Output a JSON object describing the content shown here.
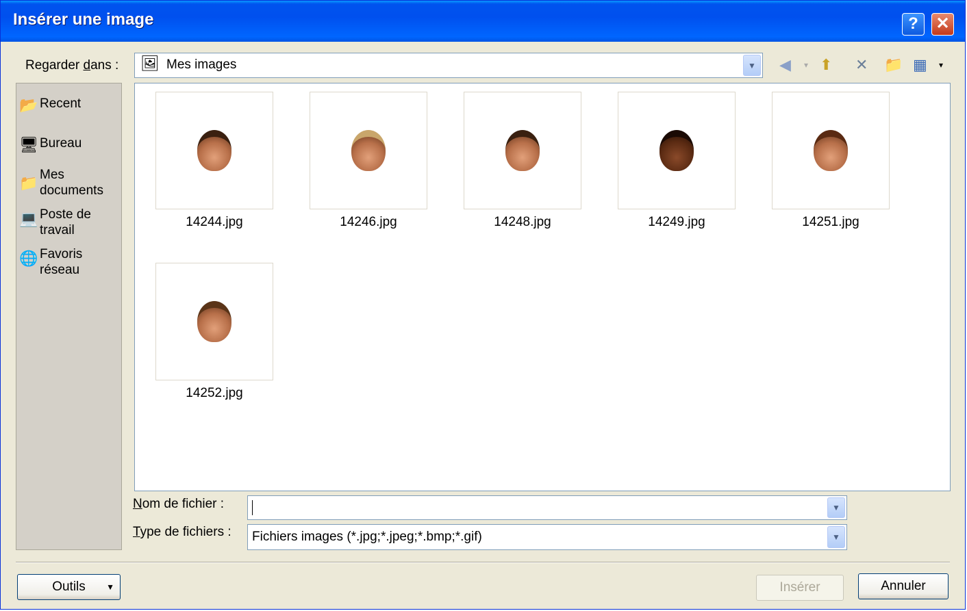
{
  "window": {
    "title": "Insérer une image",
    "help_button": "?",
    "close_button": "✕"
  },
  "lookin": {
    "label_pre": "Regarder ",
    "label_key": "d",
    "label_post": "ans :",
    "value": "Mes images"
  },
  "toolbar": {
    "icons": [
      "back-icon",
      "up-folder-icon",
      "delete-icon",
      "new-folder-icon",
      "views-menu-icon"
    ]
  },
  "places": [
    {
      "label": "Recent",
      "icon": "recent-folder-icon"
    },
    {
      "label": "Bureau",
      "icon": "desktop-icon"
    },
    {
      "label": "Mes\ndocuments",
      "icon": "my-documents-icon"
    },
    {
      "label": "Poste de\ntravail",
      "icon": "my-computer-icon"
    },
    {
      "label": "Favoris\nréseau",
      "icon": "network-places-icon"
    }
  ],
  "files": [
    {
      "name": "14244.jpg"
    },
    {
      "name": "14246.jpg"
    },
    {
      "name": "14248.jpg"
    },
    {
      "name": "14249.jpg"
    },
    {
      "name": "14251.jpg"
    },
    {
      "name": "14252.jpg"
    }
  ],
  "filename": {
    "label_key": "N",
    "label_rest": "om de fichier :",
    "value": ""
  },
  "filetype": {
    "label_key": "T",
    "label_rest": "ype de fichiers :",
    "value": "Fichiers images (*.jpg;*.jpeg;*.bmp;*.gif)"
  },
  "buttons": {
    "tools": "Outils",
    "insert": "Insérer",
    "cancel": "Annuler"
  }
}
